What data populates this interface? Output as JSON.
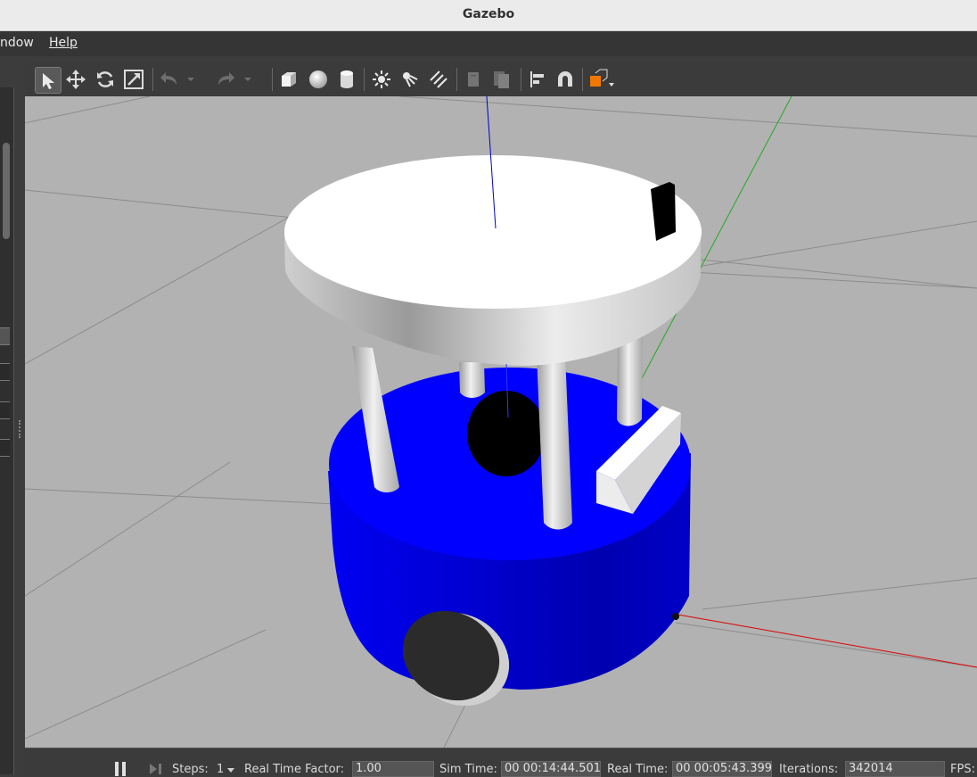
{
  "window": {
    "title": "Gazebo"
  },
  "menu": {
    "items": [
      "ndow",
      "Help"
    ]
  },
  "toolbar": {
    "tools": [
      "select-mode",
      "translate-mode",
      "rotate-mode",
      "scale-mode",
      "undo",
      "undo-history",
      "redo",
      "redo-history",
      "box-shape",
      "sphere-shape",
      "cylinder-shape",
      "point-light",
      "spot-light",
      "directional-light",
      "copy",
      "paste",
      "align",
      "snap",
      "view-angle"
    ]
  },
  "status": {
    "steps_label": "Steps:",
    "steps_value": "1",
    "rtf_label": "Real Time Factor:",
    "rtf_value": "1.00",
    "sim_time_label": "Sim Time:",
    "sim_time_value": "00 00:14:44.501",
    "real_time_label": "Real Time:",
    "real_time_value": "00 00:05:43.399",
    "iterations_label": "Iterations:",
    "iterations_value": "342014",
    "fps_label": "FPS:"
  },
  "colors": {
    "robot_base": "#0000ff",
    "plate": "#ffffff",
    "ground": "#b2b2b2",
    "axis_x": "#ff0000",
    "axis_y": "#00cc00",
    "axis_z": "#0000ff"
  }
}
